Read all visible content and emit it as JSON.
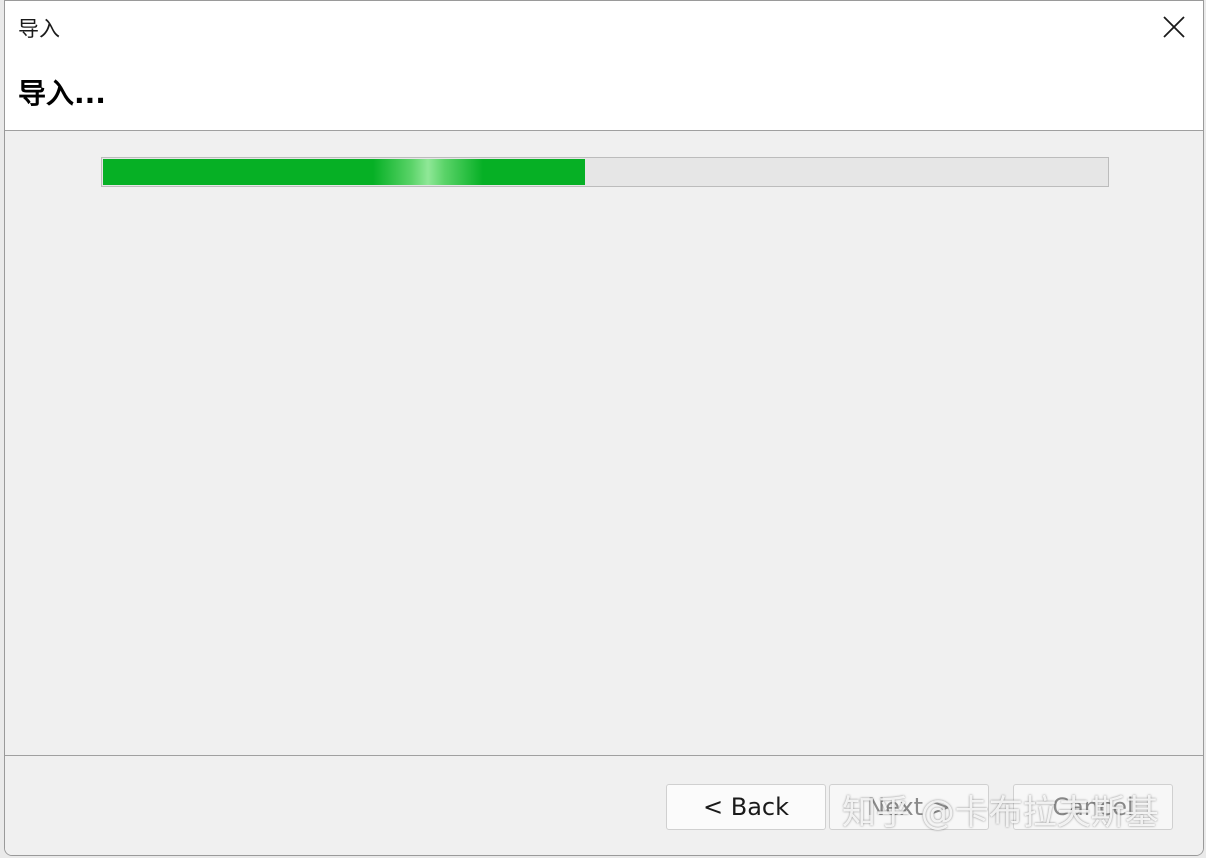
{
  "window": {
    "title": "导入",
    "close_icon": "close-icon"
  },
  "header": {
    "title": "导入..."
  },
  "progress": {
    "value_percent": 48,
    "color": "#06b025"
  },
  "buttons": {
    "back_label": "< Back",
    "next_label": "Next >",
    "cancel_label": "Cancel"
  },
  "watermark": {
    "text": "知乎 @卡布拉夫斯基"
  }
}
